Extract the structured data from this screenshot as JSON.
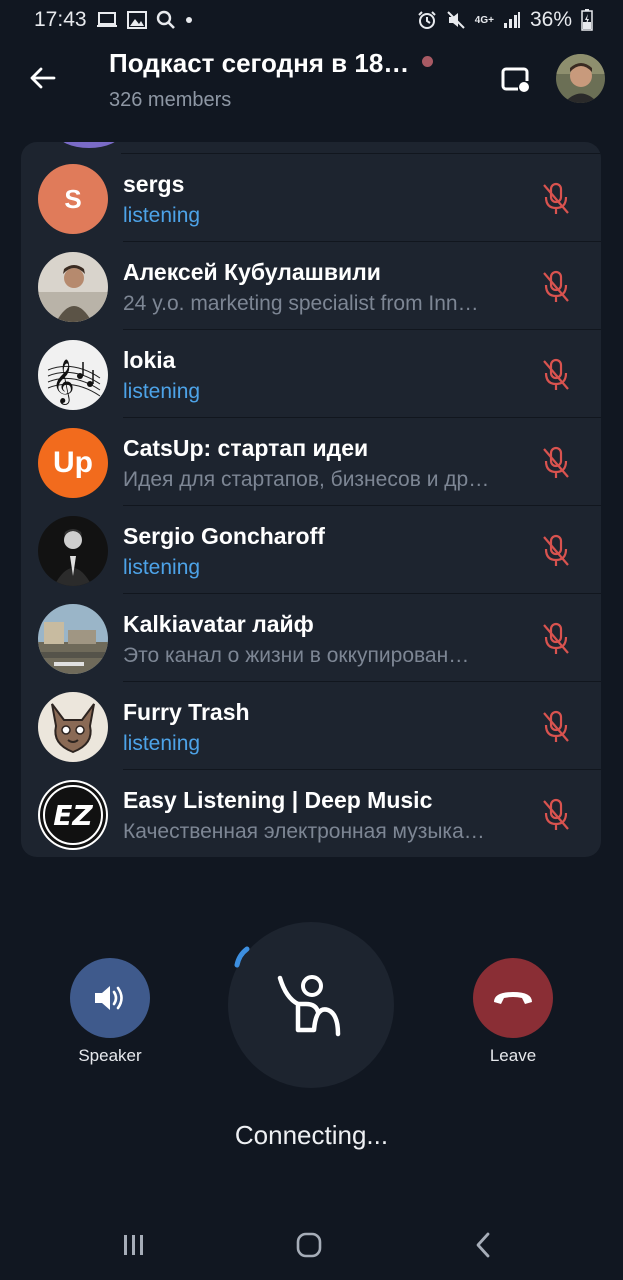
{
  "status_bar": {
    "time": "17:43",
    "battery": "36%",
    "network": "4G+",
    "left_icons": [
      "laptop-icon",
      "image-icon",
      "search-icon",
      "dot-icon"
    ],
    "right_icons": [
      "alarm-icon",
      "mute-icon",
      "network-icon",
      "signal-icon",
      "battery-charging-icon"
    ]
  },
  "header": {
    "title": "Подкаст сегодня в 18…",
    "members": "326 members",
    "live_dot_color": "#a85a64"
  },
  "participants": [
    {
      "name": "sergs",
      "status": "listening",
      "listening": true,
      "avatar": {
        "type": "letter",
        "letter": "S",
        "color": "#e07b5a"
      }
    },
    {
      "name": "Алексей Кубулашвили",
      "status": "24 y.o. marketing specialist from Inn…",
      "listening": false,
      "avatar": {
        "type": "photo",
        "color": "#c7c0b6"
      }
    },
    {
      "name": "lokia",
      "status": "listening",
      "listening": true,
      "avatar": {
        "type": "music-notes",
        "color": "#f0f0f0"
      }
    },
    {
      "name": "CatsUp: стартап идеи",
      "status": "Идея для стартапов, бизнесов и др…",
      "listening": false,
      "avatar": {
        "type": "logo",
        "text": "Up",
        "color": "#f26b1d"
      }
    },
    {
      "name": "Sergio Goncharoff",
      "status": "listening",
      "listening": true,
      "avatar": {
        "type": "photo",
        "color": "#1a1a1a"
      }
    },
    {
      "name": "Kalkiavatar лайф",
      "status": "Это канал о жизни в оккупирован…",
      "listening": false,
      "avatar": {
        "type": "photo",
        "color": "#8fa6b8"
      }
    },
    {
      "name": "Furry Trash",
      "status": "listening",
      "listening": true,
      "avatar": {
        "type": "drawing",
        "color": "#e9e4dc"
      }
    },
    {
      "name": "Easy Listening | Deep Music",
      "status": "Качественная электронная музыка…",
      "listening": false,
      "avatar": {
        "type": "logo",
        "text": "EZ",
        "color": "#ffffff"
      }
    }
  ],
  "controls": {
    "speaker_label": "Speaker",
    "leave_label": "Leave",
    "status_text": "Connecting...",
    "speaker_color": "#3f5a8c",
    "leave_color": "#8a2e35",
    "muted_mic_color": "#d9534f"
  },
  "nav_bar": {
    "items": [
      "recents-icon",
      "home-icon",
      "back-icon"
    ]
  }
}
